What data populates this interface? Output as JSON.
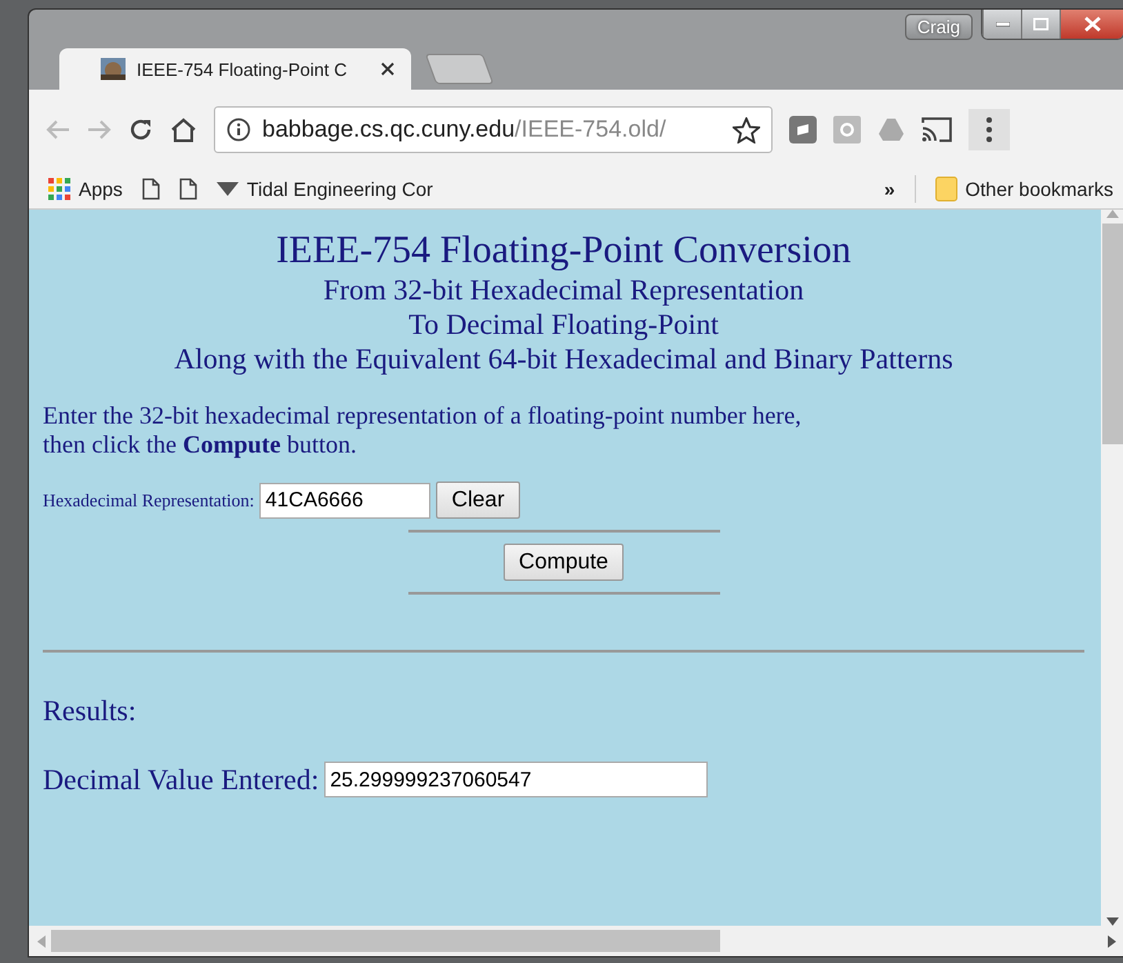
{
  "window": {
    "user": "Craig"
  },
  "tabs": [
    {
      "title": "IEEE-754 Floating-Point C",
      "selected": true,
      "kind": "page"
    },
    {
      "kind": "new",
      "selected": false
    }
  ],
  "address": {
    "host": "babbage.cs.qc.cuny.edu",
    "path": "/IEEE-754.old/"
  },
  "bookmarks": [
    {
      "kind": "apps",
      "label": "Apps"
    },
    {
      "kind": "page"
    },
    {
      "kind": "page"
    },
    {
      "kind": "site",
      "label": "Tidal Engineering Cor"
    }
  ],
  "bookmarks_overflow": "»",
  "other_bookmarks": "Other bookmarks",
  "page": {
    "title": "IEEE-754 Floating-Point Conversion",
    "subtitles": [
      "From 32-bit Hexadecimal Representation",
      "To Decimal Floating-Point",
      "Along with the Equivalent 64-bit Hexadecimal and Binary Patterns"
    ],
    "instructions": "Enter the 32-bit hexadecimal representation of a floating-point number here,\nthen click the **Compute** button.",
    "hex_field": {
      "label": "Hexadecimal Representation:",
      "value": "41CA6666"
    },
    "clear_button": "Clear",
    "compute_button": "Compute",
    "results_heading": "Results:",
    "decimal_field": {
      "label": "Decimal Value Entered:",
      "value": "25.299999237060547"
    }
  }
}
